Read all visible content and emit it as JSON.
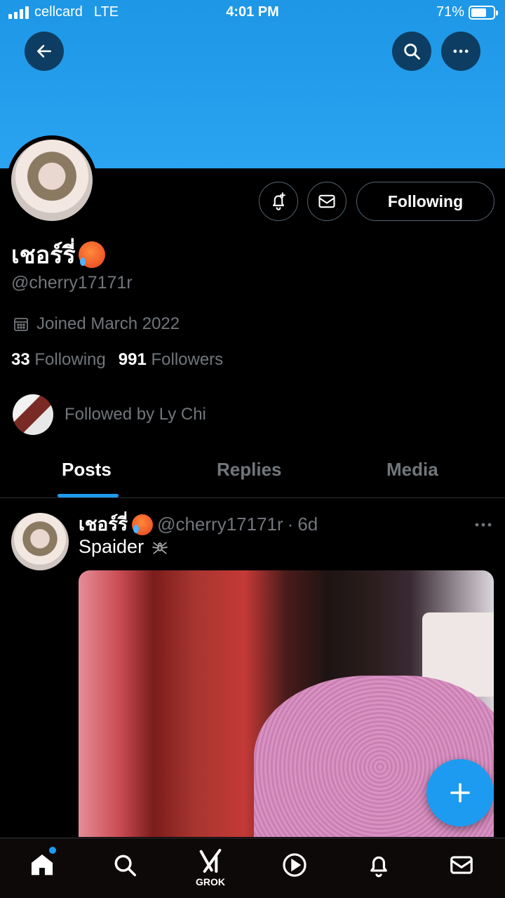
{
  "status_bar": {
    "carrier": "cellcard",
    "network": "LTE",
    "time": "4:01 PM",
    "battery_percent": "71%",
    "battery_level": 0.71
  },
  "header": {
    "back_icon": "arrow-left-icon",
    "search_icon": "search-icon",
    "more_icon": "more-horizontal-icon"
  },
  "profile": {
    "display_name": "เชอร์รี่",
    "handle": "@cherry17171r",
    "joined": "Joined March 2022",
    "following_count": "33",
    "following_label": "Following",
    "followers_count": "991",
    "followers_label": "Followers",
    "followed_by": "Followed by Ly Chi",
    "follow_button": "Following"
  },
  "tabs": [
    {
      "label": "Posts",
      "active": true
    },
    {
      "label": "Replies",
      "active": false
    },
    {
      "label": "Media",
      "active": false
    }
  ],
  "post": {
    "name": "เชอร์รี่",
    "handle": "@cherry17171r",
    "separator": "·",
    "time": "6d",
    "text": "Spaider"
  },
  "bottom_nav": {
    "grok_label": "GROK",
    "items": [
      "home-icon",
      "search-icon",
      "grok-icon",
      "play-icon",
      "bell-icon",
      "mail-icon"
    ]
  },
  "colors": {
    "accent": "#1d9bf0",
    "banner": "#1d97e6",
    "muted": "#71767b"
  }
}
